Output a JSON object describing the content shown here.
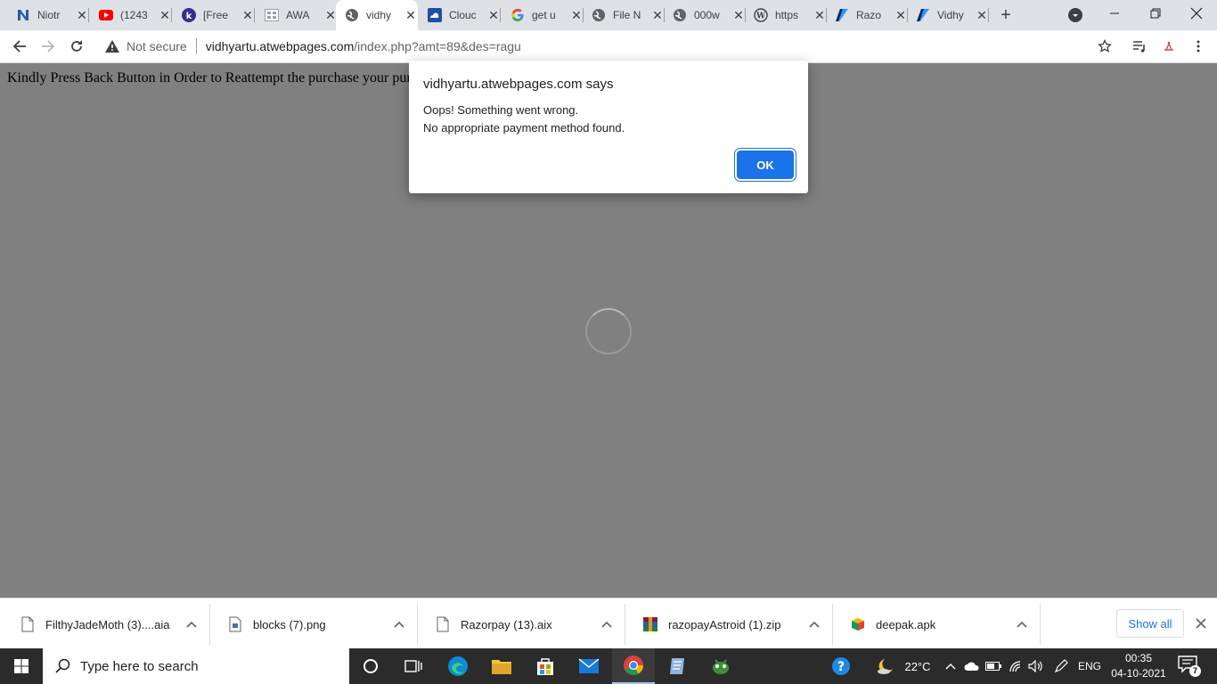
{
  "browser": {
    "tabs": [
      {
        "title": "Niotr",
        "icon": "n-logo-icon",
        "active": false
      },
      {
        "title": "(1243",
        "icon": "youtube-icon",
        "active": false
      },
      {
        "title": "[Free",
        "icon": "k-logo-icon",
        "active": false
      },
      {
        "title": "AWA",
        "icon": "grid-page-icon",
        "active": false
      },
      {
        "title": "vidhy",
        "icon": "globe-icon",
        "active": true
      },
      {
        "title": "Clouc",
        "icon": "cloud-icon",
        "active": false
      },
      {
        "title": "get u",
        "icon": "google-icon",
        "active": false
      },
      {
        "title": "File N",
        "icon": "globe-icon",
        "active": false
      },
      {
        "title": "000w",
        "icon": "globe-icon",
        "active": false
      },
      {
        "title": "https",
        "icon": "wordpress-icon",
        "active": false
      },
      {
        "title": "Razo",
        "icon": "razorpay-icon",
        "active": false
      },
      {
        "title": "Vidhy",
        "icon": "razorpay-icon",
        "active": false
      }
    ],
    "security_label": "Not secure",
    "url_host": "vidhyartu.atwebpages.com",
    "url_path": "/index.php?amt=89&des=ragu"
  },
  "page": {
    "text": "Kindly Press Back Button in Order to Reattempt the purchase your pur"
  },
  "dialog": {
    "title": "vidhyartu.atwebpages.com says",
    "line1": "Oops! Something went wrong.",
    "line2": "No appropriate payment method found.",
    "ok_label": "OK"
  },
  "downloads": {
    "items": [
      {
        "name": "FilthyJadeMoth (3)....aia",
        "icon": "file-icon"
      },
      {
        "name": "blocks (7).png",
        "icon": "image-file-icon"
      },
      {
        "name": "Razorpay (13).aix",
        "icon": "file-icon"
      },
      {
        "name": "razopayAstroid (1).zip",
        "icon": "winrar-icon"
      },
      {
        "name": "deepak.apk",
        "icon": "package-icon"
      }
    ],
    "show_all_label": "Show all"
  },
  "taskbar": {
    "search_placeholder": "Type here to search",
    "temperature": "22°C",
    "language": "ENG",
    "time": "00:35",
    "date": "04-10-2021",
    "notification_count": "7"
  },
  "colors": {
    "accent": "#1a73e8",
    "page_overlay": "#808080",
    "tab_strip": "#dee1e6",
    "taskbar": "#2b2b2b"
  }
}
